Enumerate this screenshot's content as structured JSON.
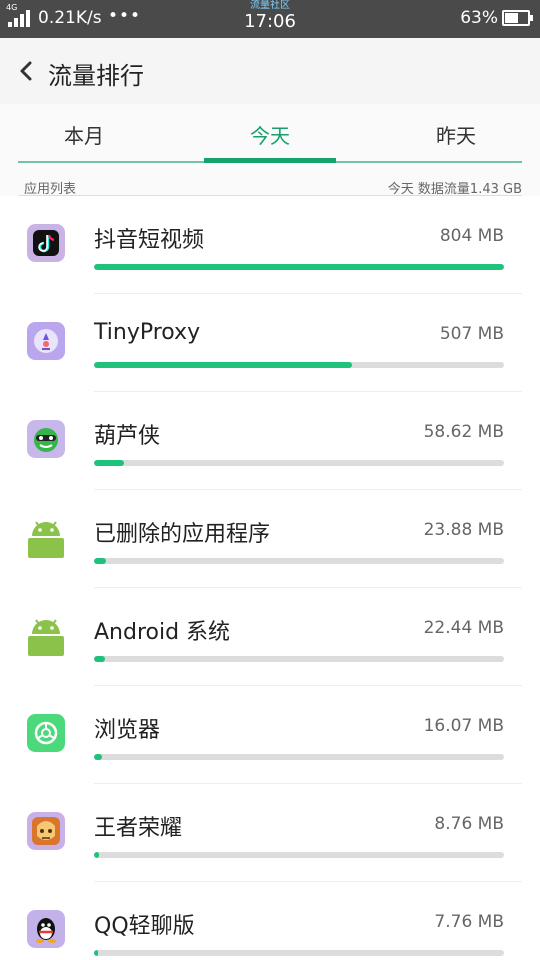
{
  "status_bar": {
    "network": "4G",
    "speed": "0.21K/s",
    "dots": "•••",
    "community": "流量社区",
    "time": "17:06",
    "battery": "63%",
    "battery_fraction": 0.63
  },
  "header": {
    "title": "流量排行"
  },
  "tabs": [
    {
      "label": "本月",
      "active": false
    },
    {
      "label": "今天",
      "active": true
    },
    {
      "label": "昨天",
      "active": false
    }
  ],
  "list": {
    "header_left": "应用列表",
    "header_right": "今天 数据流量1.43 GB",
    "items": [
      {
        "name": "抖音短视频",
        "usage": "804 MB",
        "fraction": 1.0,
        "icon": "tiktok-icon"
      },
      {
        "name": "TinyProxy",
        "usage": "507 MB",
        "fraction": 0.63,
        "icon": "tinyproxy-icon"
      },
      {
        "name": "葫芦侠",
        "usage": "58.62 MB",
        "fraction": 0.073,
        "icon": "huluxia-icon"
      },
      {
        "name": "已删除的应用程序",
        "usage": "23.88 MB",
        "fraction": 0.03,
        "icon": "android-icon"
      },
      {
        "name": "Android 系统",
        "usage": "22.44 MB",
        "fraction": 0.028,
        "icon": "android-icon"
      },
      {
        "name": "浏览器",
        "usage": "16.07 MB",
        "fraction": 0.02,
        "icon": "browser-icon"
      },
      {
        "name": "王者荣耀",
        "usage": "8.76 MB",
        "fraction": 0.011,
        "icon": "honor-of-kings-icon"
      },
      {
        "name": "QQ轻聊版",
        "usage": "7.76 MB",
        "fraction": 0.01,
        "icon": "qq-icon"
      }
    ]
  },
  "colors": {
    "accent": "#14a46b",
    "bar_fill": "#1fc27a",
    "bar_track": "#dcdcdc"
  }
}
